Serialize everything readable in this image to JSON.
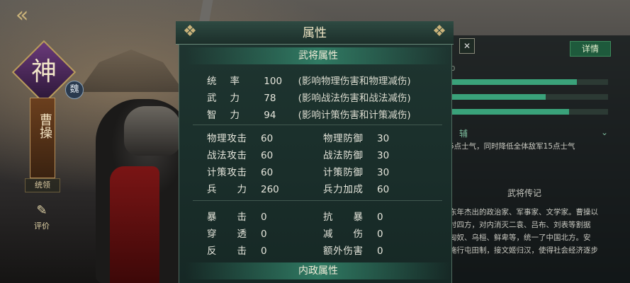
{
  "sidebar": {
    "back_icon": "back-arrow-icon",
    "emblem": "神",
    "kingdom": "魏",
    "hero_name": "曹操",
    "tab_lead": "统领",
    "review_label": "评价"
  },
  "right_panel": {
    "detail_button": "详情",
    "rank_letter": "0",
    "bars": [
      0.8,
      0.6,
      0.75
    ],
    "aux_tag": "辅",
    "skill_desc": "5点士气，同时降低全体敌军15点士气",
    "bio_title": "武将传记",
    "bio_lines": [
      "东年杰出的政治家、军事家、文学家。曹操以",
      "讨四方，对内消灭二袁、吕布、刘表等割据",
      "匈奴、乌桓、鲜卑等，统一了中国北方。安",
      "施行屯田制，接文姬归汉，使得社会经济逐步"
    ]
  },
  "modal": {
    "title": "属性",
    "section_general": "武将属性",
    "section_domestic": "内政属性",
    "core_stats": [
      {
        "label": "统率",
        "value": "100",
        "note": "(影响物理伤害和物理减伤)"
      },
      {
        "label": "武力",
        "value": "78",
        "note": "(影响战法伤害和战法减伤)"
      },
      {
        "label": "智力",
        "value": "94",
        "note": "(影响计策伤害和计策减伤)"
      }
    ],
    "combat_left": [
      {
        "label": "物理攻击",
        "value": "60"
      },
      {
        "label": "战法攻击",
        "value": "60"
      },
      {
        "label": "计策攻击",
        "value": "60"
      },
      {
        "label": "兵力",
        "value": "260"
      }
    ],
    "combat_right": [
      {
        "label": "物理防御",
        "value": "30"
      },
      {
        "label": "战法防御",
        "value": "30"
      },
      {
        "label": "计策防御",
        "value": "30"
      },
      {
        "label": "兵力加成",
        "value": "60"
      }
    ],
    "extra_left": [
      {
        "label": "暴击",
        "value": "0"
      },
      {
        "label": "穿透",
        "value": "0"
      },
      {
        "label": "反击",
        "value": "0"
      }
    ],
    "extra_right": [
      {
        "label": "抗暴",
        "value": "0"
      },
      {
        "label": "减伤",
        "value": "0"
      },
      {
        "label": "额外伤害",
        "value": "0"
      }
    ]
  }
}
